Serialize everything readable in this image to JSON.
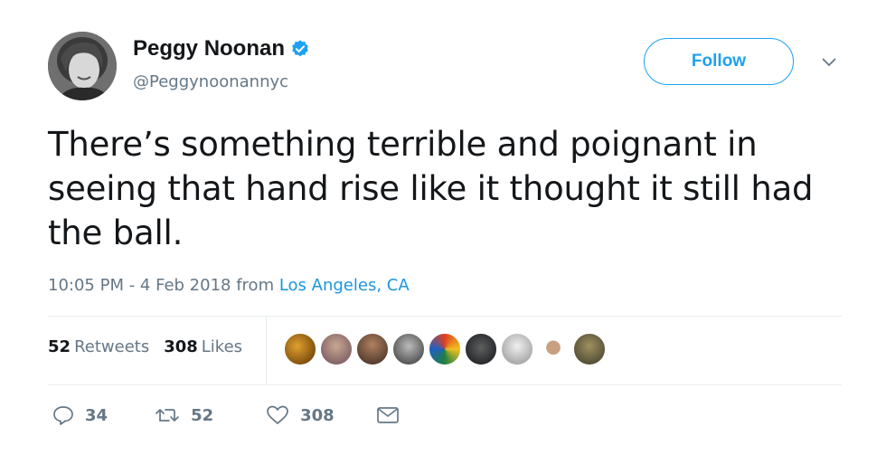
{
  "author": {
    "display_name": "Peggy Noonan",
    "handle": "@Peggynoonannyc",
    "verified_icon": "verified-badge-icon"
  },
  "follow_label": "Follow",
  "tweet": {
    "text": "There’s something terrible and poignant in seeing that hand rise like it thought it still had the ball.",
    "timestamp": "10:05 PM - 4 Feb 2018 from ",
    "location": "Los Angeles, CA"
  },
  "stats": {
    "retweets_count": "52",
    "retweets_label": "Retweets",
    "likes_count": "308",
    "likes_label": "Likes"
  },
  "liker_avatars": 9,
  "actions": {
    "reply_count": "34",
    "retweet_count": "52",
    "like_count": "308"
  },
  "colors": {
    "accent": "#1da1f2",
    "link": "#1b95e0",
    "secondary_text": "#657786",
    "divider": "#e6ecf0"
  }
}
